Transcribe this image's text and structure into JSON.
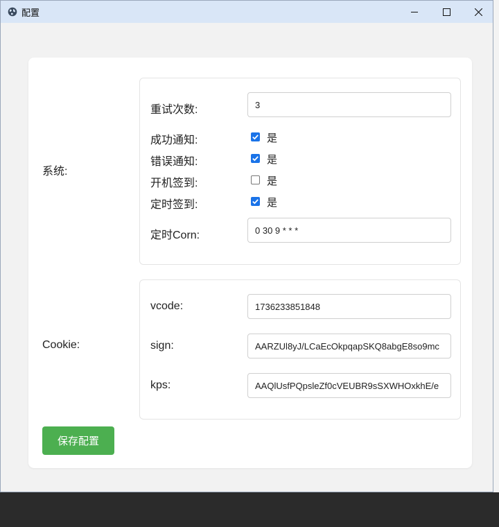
{
  "window": {
    "title": "配置"
  },
  "system": {
    "label": "系统:",
    "retry": {
      "label": "重试次数:",
      "value": "3"
    },
    "options": [
      {
        "label": "成功通知:",
        "checked": true,
        "text": "是"
      },
      {
        "label": "错误通知:",
        "checked": true,
        "text": "是"
      },
      {
        "label": "开机签到:",
        "checked": false,
        "text": "是"
      },
      {
        "label": "定时签到:",
        "checked": true,
        "text": "是"
      }
    ],
    "cron": {
      "label": "定时Corn:",
      "value": "0 30 9 * * *"
    }
  },
  "cookie": {
    "label": "Cookie:",
    "vcode": {
      "label": "vcode:",
      "value": "1736233851848"
    },
    "sign": {
      "label": "sign:",
      "value": "AARZUl8yJ/LCaEcOkpqapSKQ8abgE8so9mc"
    },
    "kps": {
      "label": "kps:",
      "value": "AAQlUsfPQpsleZf0cVEUBR9sSXWHOxkhE/e"
    }
  },
  "actions": {
    "save_label": "保存配置"
  },
  "colors": {
    "accent": "#1a73e8",
    "save": "#4caf50",
    "titlebar": "#d9e6f7"
  }
}
